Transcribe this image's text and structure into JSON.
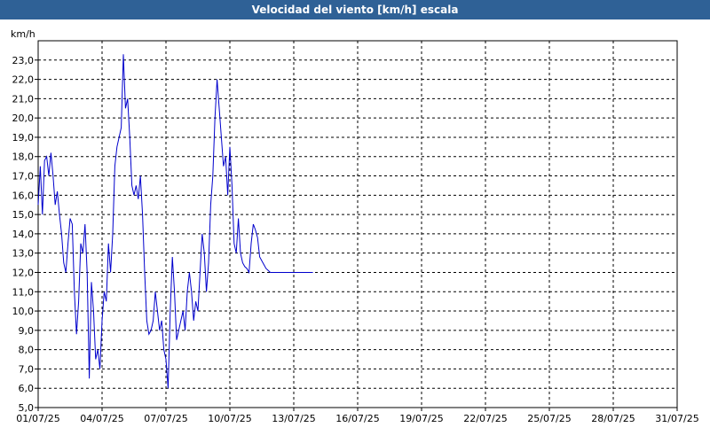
{
  "window": {
    "title": "Velocidad del viento [km/h] escala"
  },
  "chart_data": {
    "type": "line",
    "title": "Velocidad del viento [km/h] escala",
    "ylabel": "km/h",
    "xlabel": "",
    "ylim": [
      5.0,
      24.0
    ],
    "xlim": [
      "01/07/25",
      "31/07/25"
    ],
    "grid": true,
    "y_ticks": [
      "5,0",
      "6,0",
      "7,0",
      "8,0",
      "9,0",
      "10,0",
      "11,0",
      "12,0",
      "13,0",
      "14,0",
      "15,0",
      "16,0",
      "17,0",
      "18,0",
      "19,0",
      "20,0",
      "21,0",
      "22,0",
      "23,0"
    ],
    "x_ticks": [
      "01/07/25",
      "04/07/25",
      "07/07/25",
      "10/07/25",
      "13/07/25",
      "16/07/25",
      "19/07/25",
      "22/07/25",
      "25/07/25",
      "28/07/25",
      "31/07/25"
    ],
    "series": [
      {
        "color": "#0000cc",
        "x": [
          1.0,
          1.1,
          1.2,
          1.3,
          1.4,
          1.5,
          1.6,
          1.7,
          1.8,
          1.9,
          2.0,
          2.1,
          2.2,
          2.3,
          2.4,
          2.5,
          2.6,
          2.7,
          2.8,
          2.9,
          3.0,
          3.1,
          3.2,
          3.3,
          3.4,
          3.5,
          3.6,
          3.7,
          3.8,
          3.9,
          4.0,
          4.1,
          4.2,
          4.3,
          4.4,
          4.5,
          4.6,
          4.7,
          4.8,
          4.9,
          5.0,
          5.1,
          5.2,
          5.3,
          5.4,
          5.5,
          5.6,
          5.7,
          5.8,
          5.9,
          6.0,
          6.1,
          6.2,
          6.3,
          6.4,
          6.5,
          6.6,
          6.7,
          6.8,
          6.9,
          7.0,
          7.1,
          7.2,
          7.3,
          7.4,
          7.5,
          7.6,
          7.7,
          7.8,
          7.9,
          8.0,
          8.1,
          8.2,
          8.3,
          8.4,
          8.5,
          8.6,
          8.7,
          8.8,
          8.9,
          9.0,
          9.1,
          9.2,
          9.3,
          9.4,
          9.5,
          9.6,
          9.7,
          9.8,
          9.9,
          10.0,
          10.1,
          10.2,
          10.3,
          10.4,
          10.5,
          10.6,
          10.7,
          10.8,
          10.9,
          11.0,
          11.1,
          11.2,
          11.3,
          11.4,
          11.5,
          11.6,
          11.7,
          11.8,
          11.9,
          12.0,
          12.1,
          12.2,
          12.3,
          12.4,
          12.5,
          12.6,
          12.7,
          12.8,
          12.9,
          13.0,
          13.1,
          13.2,
          13.3,
          13.4,
          13.5,
          13.6,
          13.7,
          13.8,
          13.9
        ],
        "values": [
          15.5,
          17.5,
          15.0,
          17.8,
          18.0,
          17.0,
          18.2,
          17.0,
          15.5,
          16.2,
          15.0,
          14.0,
          12.5,
          12.0,
          13.5,
          14.8,
          14.5,
          11.0,
          8.8,
          10.5,
          13.5,
          13.0,
          14.5,
          12.0,
          6.5,
          11.5,
          10.0,
          7.5,
          8.0,
          7.0,
          9.5,
          11.0,
          10.5,
          13.5,
          12.0,
          14.0,
          17.5,
          18.5,
          19.0,
          19.5,
          23.3,
          20.5,
          21.0,
          19.0,
          16.5,
          16.0,
          16.5,
          15.8,
          17.0,
          15.0,
          12.0,
          9.5,
          8.8,
          9.0,
          9.5,
          11.0,
          10.0,
          9.0,
          9.5,
          8.0,
          7.5,
          6.0,
          10.0,
          12.8,
          11.0,
          8.5,
          9.0,
          9.5,
          10.0,
          9.0,
          11.0,
          12.0,
          11.0,
          9.5,
          10.5,
          10.0,
          12.0,
          14.0,
          13.0,
          11.0,
          12.5,
          15.5,
          17.0,
          20.0,
          22.0,
          20.5,
          19.0,
          17.5,
          18.0,
          16.0,
          18.5,
          16.5,
          13.5,
          13.0,
          14.8,
          13.0,
          12.5,
          12.3,
          12.2,
          12.0,
          13.5,
          14.5,
          14.2,
          13.8,
          12.8,
          12.6,
          12.4,
          12.2,
          12.1,
          12.0,
          12.0,
          12.0,
          12.0,
          12.0,
          12.0,
          12.0,
          12.0,
          12.0,
          12.0,
          12.0,
          12.0,
          12.0,
          12.0,
          12.0,
          12.0,
          12.0,
          12.0,
          12.0,
          12.0,
          12.0
        ]
      }
    ]
  }
}
